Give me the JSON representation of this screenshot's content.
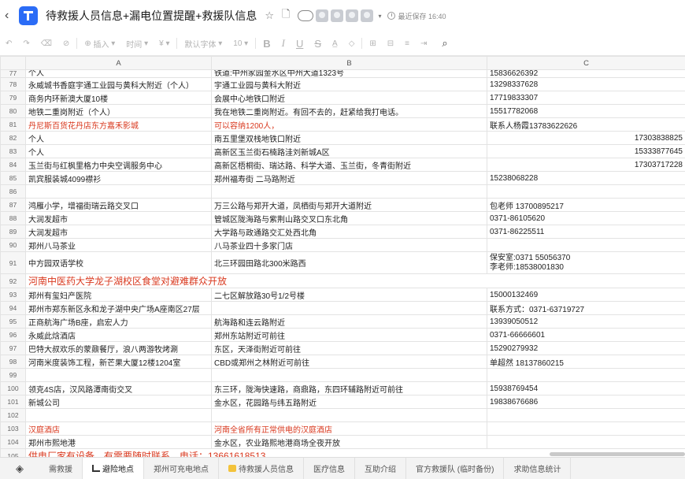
{
  "titlebar": {
    "title": "待救援人员信息+漏电位置提醒+救援队信息",
    "save_status": "最近保存 16:40"
  },
  "toolbar": {
    "insert_label": "插入",
    "time_label": "时间",
    "font_label": "默认字体",
    "size_label": "10",
    "bold_label": "B",
    "italic_label": "I",
    "underline_label": "U",
    "strike_label": "S"
  },
  "columns": [
    "A",
    "B",
    "C"
  ],
  "rows": [
    {
      "n": "77",
      "a": "个人",
      "b": "铁道:中州家园金水区中州大道1323号",
      "c": "15836626392",
      "style": "partial"
    },
    {
      "n": "78",
      "a": "永威城书香庭宇通工业园与黄科大附近（个人）",
      "b": "宇通工业园与黄科大附近",
      "c": "13298337628"
    },
    {
      "n": "79",
      "a": "商务内环新澳大厦10楼",
      "b": "会展中心地铁口附近",
      "c": "17719833307"
    },
    {
      "n": "80",
      "a": "地铁二重岗附近（个人）",
      "b": "我在地铁二重岗附近。有回不去的，赶紧给我打电话。",
      "c": "15517782068"
    },
    {
      "n": "81",
      "a": "丹尼斯百货花丹店东方嘉禾影城",
      "b": "可以容纳1200人，",
      "c": "联系人杨霞13783622626",
      "style": "red-ab"
    },
    {
      "n": "82",
      "a": "个人",
      "b": "南五里堡双栈地铁口附近",
      "c": "17303838825",
      "style": "c-right"
    },
    {
      "n": "83",
      "a": "个人",
      "b": "高新区玉兰街石楠路洼刘新城A区",
      "c": "15333877645",
      "style": "c-right"
    },
    {
      "n": "84",
      "a": "玉兰街与红枫里格力中央空调服务中心",
      "b": "高新区梧桐街、瑞达路、科学大道、玉兰街，冬青街附近",
      "c": "17303717228",
      "style": "c-right"
    },
    {
      "n": "85",
      "a": "凯宾服装城4099襟衫",
      "b": "郑州福寿街 二马路附近",
      "c": "15238068228"
    },
    {
      "n": "86",
      "a": "",
      "b": "",
      "c": ""
    },
    {
      "n": "87",
      "a": "鸿雁小学，增福街瑞云路交叉口",
      "b": "万三公路与郑开大道，凤栖街与郑开大道附近",
      "c": "包老师 13700895217"
    },
    {
      "n": "88",
      "a": "大润发超市",
      "b": "管城区陇海路与紫荆山路交叉口东北角",
      "c": "0371-86105620"
    },
    {
      "n": "89",
      "a": "大润发超市",
      "b": "大学路与政通路交汇处西北角",
      "c": "0371-86225511"
    },
    {
      "n": "90",
      "a": "郑州八马茶业",
      "b": "八马茶业四十多家门店",
      "c": ""
    },
    {
      "n": "91",
      "a": "中方园双语学校",
      "b": "北三环园田路北300米路西",
      "c": "保安室:0371 55056370\n李老师:18538001830",
      "style": "tall"
    },
    {
      "n": "92",
      "a": "河南中医药大学龙子湖校区食堂对避难群众开放",
      "b": "",
      "c": "",
      "style": "red-big"
    },
    {
      "n": "93",
      "a": "郑州有玺妇产医院",
      "b": "二七区解放路30号1/2号楼",
      "c": "15000132469"
    },
    {
      "n": "94",
      "a": "郑州市郑东新区永和龙子湖中央广场A座南区27层",
      "b": "",
      "c": "联系方式：0371-63719727"
    },
    {
      "n": "95",
      "a": "正商航海广场B座，启宏人力",
      "b": "航海路和连云路附近",
      "c": "13939050512"
    },
    {
      "n": "96",
      "a": "永威此焓酒店",
      "b": "郑州东站附近可前往",
      "c": "0371-66666601"
    },
    {
      "n": "97",
      "a": "巴特大叔欢乐的蒙鼐餐厅，浪八两游牧烤涮",
      "b": "东区，天泽街附近可前往",
      "c": "15290279932"
    },
    {
      "n": "98",
      "a": "河南米度装饰工程，新芒果大厦12楼1204室",
      "b": "CBD或郑州之林附近可前往",
      "c": "单超然 18137860215"
    },
    {
      "n": "99",
      "a": "",
      "b": "",
      "c": ""
    },
    {
      "n": "100",
      "a": "领克4S店，汉风路潭南街交叉",
      "b": "东三环，陇海快速路，商鼎路，东四环辅路附近可前往",
      "c": "15938769454"
    },
    {
      "n": "101",
      "a": "新城公司",
      "b": "金水区，花园路与纬五路附近",
      "c": "19838676686"
    },
    {
      "n": "102",
      "a": "",
      "b": "",
      "c": ""
    },
    {
      "n": "103",
      "a": "汉庭酒店",
      "b": "河南全省所有正常供电的汉庭酒店",
      "c": "",
      "style": "red-ab-bold"
    },
    {
      "n": "104",
      "a": "郑州市熙地港",
      "b": "金水区，农业路熙地港商场全夜开放",
      "c": ""
    },
    {
      "n": "105",
      "a": "供电厂家有设备，有需要随时联系，电话：13661618513",
      "b": "",
      "c": "",
      "style": "red-big-bold"
    }
  ],
  "tabs": [
    {
      "label": "需救援",
      "active": false,
      "icon": ""
    },
    {
      "label": "避险地点",
      "active": true,
      "icon": "bed-icon"
    },
    {
      "label": "郑州可充电地点",
      "active": false,
      "icon": ""
    },
    {
      "label": "待救援人员信息",
      "active": false,
      "icon": "note-icon"
    },
    {
      "label": "医疗信息",
      "active": false,
      "icon": ""
    },
    {
      "label": "互助介绍",
      "active": false,
      "icon": ""
    },
    {
      "label": "官方救援队 (临时备份)",
      "active": false,
      "icon": ""
    },
    {
      "label": "求助信息统计",
      "active": false,
      "icon": ""
    }
  ]
}
